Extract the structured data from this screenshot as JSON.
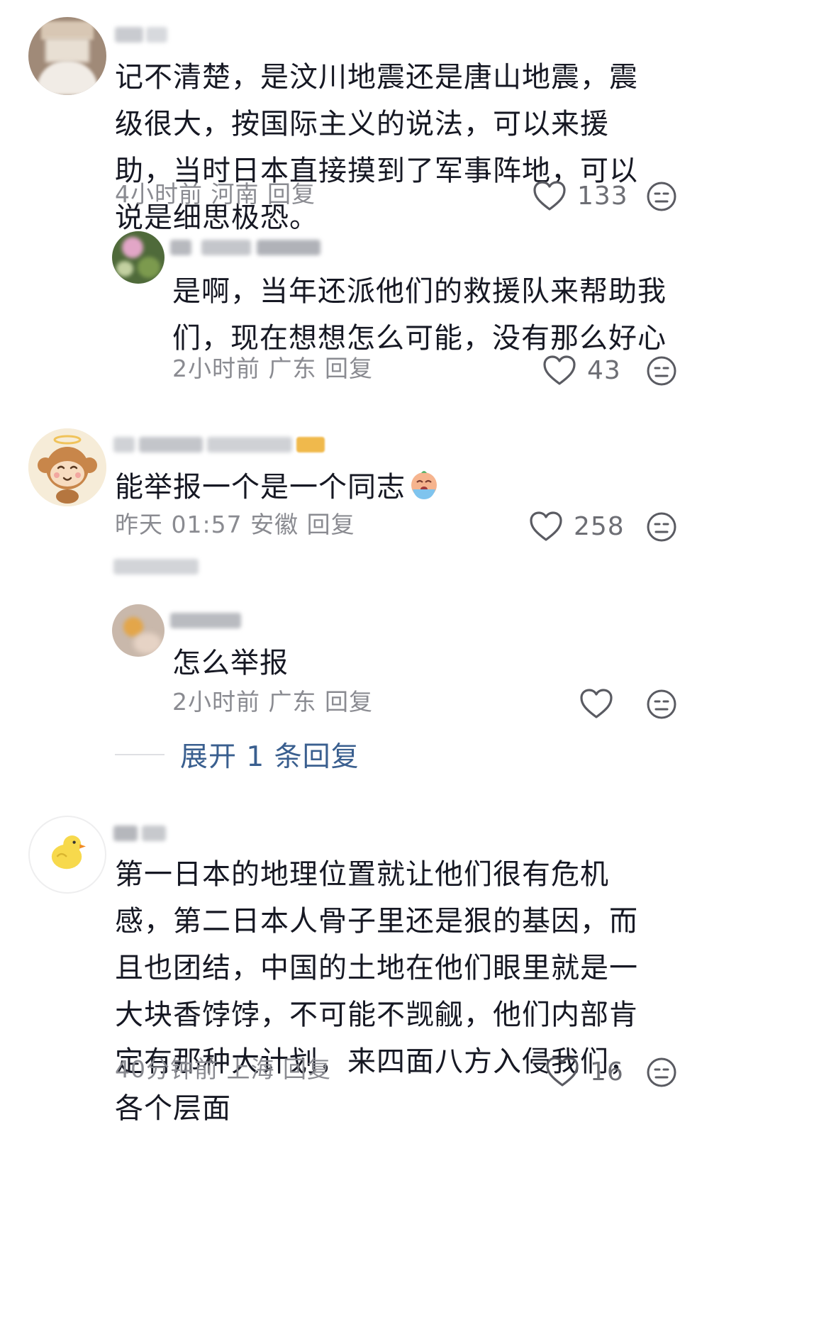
{
  "comments": [
    {
      "text": "记不清楚，是汶川地震还是唐山地震，震级很大，按国际主义的说法，可以来援助，当时日本直接摸到了军事阵地，可以说是细思极恐。",
      "meta": "4小时前 河南 回复",
      "likes": "133"
    },
    {
      "text": "是啊，当年还派他们的救援队来帮助我们，现在想想怎么可能，没有那么好心",
      "meta": "2小时前 广东 回复",
      "likes": "43"
    },
    {
      "text": "能举报一个是一个同志",
      "meta": "昨天 01:57 安徽 回复",
      "likes": "258"
    },
    {
      "text": "怎么举报",
      "meta": "2小时前 广东 回复",
      "likes": ""
    },
    {
      "text": "第一日本的地理位置就让他们很有危机感，第二日本人骨子里还是狠的基因，而且也团结，中国的土地在他们眼里就是一大块香饽饽，不可能不觊觎，他们内部肯定有那种大计划，来四面八方入侵我们，各个层面",
      "meta": "40分钟前 上海 回复",
      "likes": "16"
    }
  ],
  "expand_replies": "展开 1 条回复",
  "icons": {
    "like": "heart-outline-icon",
    "dislike": "meh-face-icon",
    "reaction": "crying-face-emoji-icon"
  },
  "colors": {
    "text": "#161823",
    "meta": "#8a8b91",
    "link": "#3a5f8f"
  }
}
